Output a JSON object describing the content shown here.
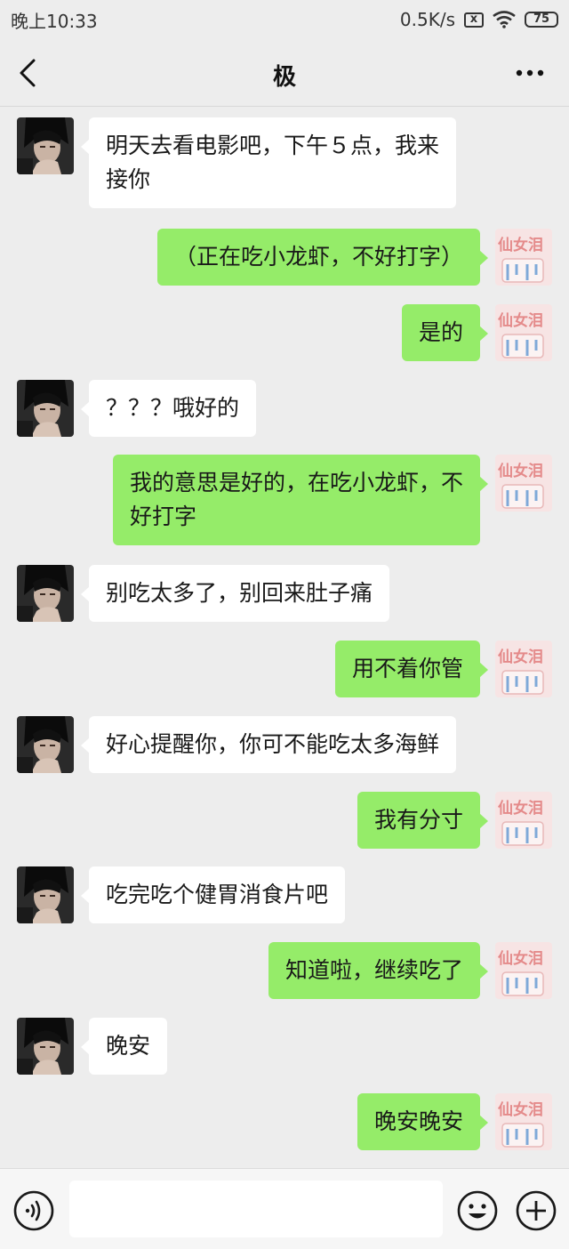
{
  "status_bar": {
    "time": "晚上10:33",
    "network_speed": "0.5K/s",
    "sim_icon": "x",
    "battery": "75"
  },
  "nav": {
    "title": "极",
    "back_icon": "chevron-left-icon",
    "more_icon": "more-dots-icon"
  },
  "messages": [
    {
      "side": "in",
      "text": "明天去看电影吧，下午５点，我来\n接你"
    },
    {
      "side": "out",
      "text": "（正在吃小龙虾，不好打字）"
    },
    {
      "side": "out",
      "text": "是的"
    },
    {
      "side": "in",
      "text": "？？？哦好的"
    },
    {
      "side": "out",
      "text": "我的意思是好的，在吃小龙虾，不\n好打字"
    },
    {
      "side": "in",
      "text": "别吃太多了，别回来肚子痛"
    },
    {
      "side": "out",
      "text": "用不着你管"
    },
    {
      "side": "in",
      "text": "好心提醒你，你可不能吃太多海鲜"
    },
    {
      "side": "out",
      "text": "我有分寸"
    },
    {
      "side": "in",
      "text": "吃完吃个健胃消食片吧"
    },
    {
      "side": "out",
      "text": "知道啦，继续吃了"
    },
    {
      "side": "in",
      "text": "晚安"
    },
    {
      "side": "out",
      "text": "晚安晚安"
    }
  ],
  "input_bar": {
    "placeholder": "",
    "voice_icon": "voice-icon",
    "emoji_icon": "emoji-icon",
    "plus_icon": "plus-icon"
  },
  "colors": {
    "background": "#ededed",
    "incoming_bubble": "#ffffff",
    "outgoing_bubble": "#95ec69"
  }
}
